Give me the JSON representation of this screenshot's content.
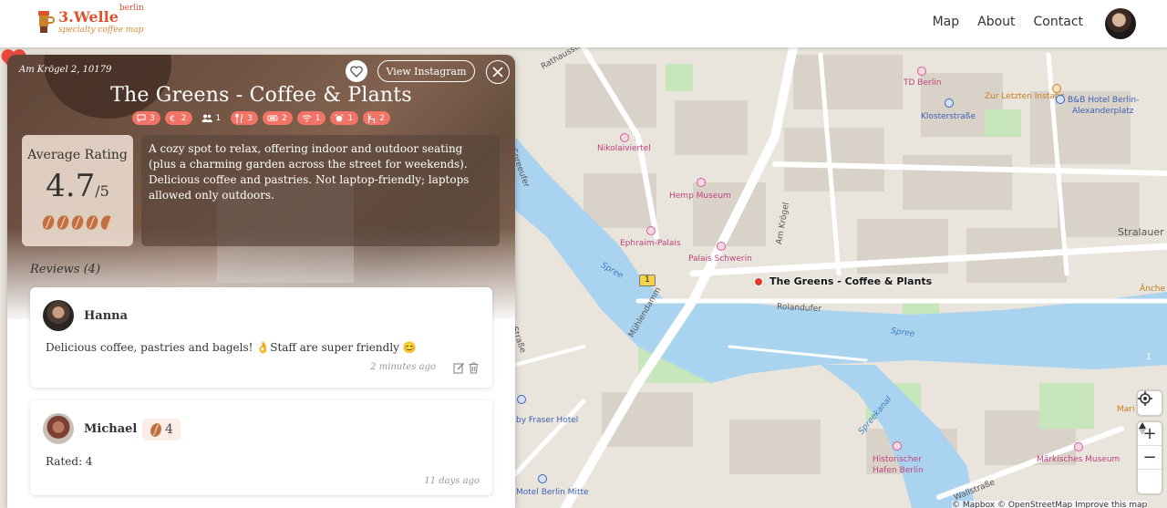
{
  "header": {
    "logo_name": "3.Welle",
    "logo_sup": "berlin",
    "logo_sub": "specialty coffee map",
    "nav": [
      "Map",
      "About",
      "Contact"
    ]
  },
  "map": {
    "cafe_label": "The Greens - Coffee & Plants",
    "labels": {
      "td_berlin": "TD Berlin",
      "klosterstrasse": "Klosterstraße",
      "zur_letzten_instanz": "Zur Letzten Instanz",
      "bb_hotel": "B&B Hotel Berlin-",
      "bb_hotel2": "Alexanderplatz",
      "nikolaiviertel": "Nikolaiviertel",
      "hemp_museum": "Hemp Museum",
      "ephraim_palais": "Ephraim-Palais",
      "palais_schwerin": "Palais Schwerin",
      "am_kroegel": "Am Krögel",
      "stralauer": "Stralauer",
      "rolandufer": "Rolandufer",
      "spree1": "Spree",
      "spree2": "Spree",
      "spreeufer": "Spreeufer",
      "muehlendamm": "Mühlendamm",
      "spreekanal": "Spreekanal",
      "historischer": "Historischer",
      "hafen_berlin": "Hafen Berlin",
      "maerkisches": "Märkisches Museum",
      "wallstrasse": "Wallstraße",
      "fraser": "by Fraser Hotel",
      "motel_one": "Motel Berlin Mitte",
      "rathausstr": "Rathausstr",
      "strasse": "Straße",
      "anche": "Änche",
      "mari": "Mari",
      "route_number": "1"
    },
    "cluster_count": "1",
    "attribution": "© Mapbox © OpenStreetMap  Improve this map"
  },
  "cafe": {
    "address": "Am Krögel 2, 10179",
    "instagram_label": "View Instagram",
    "name": "The Greens - Coffee & Plants",
    "badges": [
      {
        "icon": "chat-icon",
        "value": "3",
        "style": "pink"
      },
      {
        "icon": "euro-icon",
        "value": "2",
        "style": "pink"
      },
      {
        "icon": "people-icon",
        "value": "1",
        "style": "dark"
      },
      {
        "icon": "cutlery-icon",
        "value": "3",
        "style": "pink"
      },
      {
        "icon": "sofa-icon",
        "value": "2",
        "style": "pink"
      },
      {
        "icon": "wifi-icon",
        "value": "1",
        "style": "pink"
      },
      {
        "icon": "alarm-icon",
        "value": "1",
        "style": "pink"
      },
      {
        "icon": "chair-icon",
        "value": "2",
        "style": "pink"
      }
    ],
    "rating_label": "Average Rating",
    "rating_value": "4.7",
    "rating_max": "/5",
    "description": "A cozy spot to relax, offering indoor and outdoor seating (plus a charming garden across the street for weekends). Delicious coffee and pastries. Not laptop-friendly; laptops allowed only outdoors.",
    "reviews_title": "Reviews (4)",
    "reviews": [
      {
        "name": "Hanna",
        "text": "Delicious coffee, pastries and bagels! 👌Staff are super friendly 😊",
        "time": "2 minutes ago"
      },
      {
        "name": "Michael",
        "rating": "4",
        "text": "Rated: 4",
        "time": "11 days ago"
      }
    ]
  },
  "colors": {
    "brand": "#e0522d",
    "badge": "#f27466",
    "water": "#aad3f0",
    "park": "#c8e6bc",
    "marker": "#e33b2e"
  }
}
